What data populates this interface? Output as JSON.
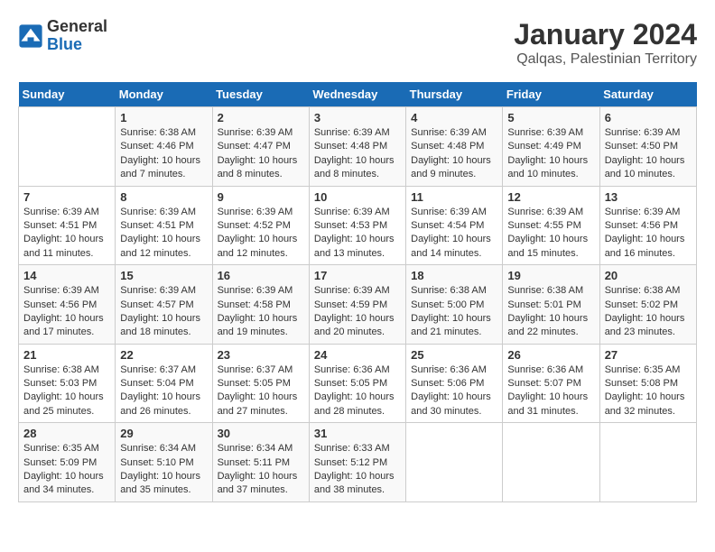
{
  "logo": {
    "general": "General",
    "blue": "Blue"
  },
  "title": "January 2024",
  "subtitle": "Qalqas, Palestinian Territory",
  "days_of_week": [
    "Sunday",
    "Monday",
    "Tuesday",
    "Wednesday",
    "Thursday",
    "Friday",
    "Saturday"
  ],
  "weeks": [
    [
      {
        "day": "",
        "info": ""
      },
      {
        "day": "1",
        "info": "Sunrise: 6:38 AM\nSunset: 4:46 PM\nDaylight: 10 hours\nand 7 minutes."
      },
      {
        "day": "2",
        "info": "Sunrise: 6:39 AM\nSunset: 4:47 PM\nDaylight: 10 hours\nand 8 minutes."
      },
      {
        "day": "3",
        "info": "Sunrise: 6:39 AM\nSunset: 4:48 PM\nDaylight: 10 hours\nand 8 minutes."
      },
      {
        "day": "4",
        "info": "Sunrise: 6:39 AM\nSunset: 4:48 PM\nDaylight: 10 hours\nand 9 minutes."
      },
      {
        "day": "5",
        "info": "Sunrise: 6:39 AM\nSunset: 4:49 PM\nDaylight: 10 hours\nand 10 minutes."
      },
      {
        "day": "6",
        "info": "Sunrise: 6:39 AM\nSunset: 4:50 PM\nDaylight: 10 hours\nand 10 minutes."
      }
    ],
    [
      {
        "day": "7",
        "info": "Sunrise: 6:39 AM\nSunset: 4:51 PM\nDaylight: 10 hours\nand 11 minutes."
      },
      {
        "day": "8",
        "info": "Sunrise: 6:39 AM\nSunset: 4:51 PM\nDaylight: 10 hours\nand 12 minutes."
      },
      {
        "day": "9",
        "info": "Sunrise: 6:39 AM\nSunset: 4:52 PM\nDaylight: 10 hours\nand 12 minutes."
      },
      {
        "day": "10",
        "info": "Sunrise: 6:39 AM\nSunset: 4:53 PM\nDaylight: 10 hours\nand 13 minutes."
      },
      {
        "day": "11",
        "info": "Sunrise: 6:39 AM\nSunset: 4:54 PM\nDaylight: 10 hours\nand 14 minutes."
      },
      {
        "day": "12",
        "info": "Sunrise: 6:39 AM\nSunset: 4:55 PM\nDaylight: 10 hours\nand 15 minutes."
      },
      {
        "day": "13",
        "info": "Sunrise: 6:39 AM\nSunset: 4:56 PM\nDaylight: 10 hours\nand 16 minutes."
      }
    ],
    [
      {
        "day": "14",
        "info": "Sunrise: 6:39 AM\nSunset: 4:56 PM\nDaylight: 10 hours\nand 17 minutes."
      },
      {
        "day": "15",
        "info": "Sunrise: 6:39 AM\nSunset: 4:57 PM\nDaylight: 10 hours\nand 18 minutes."
      },
      {
        "day": "16",
        "info": "Sunrise: 6:39 AM\nSunset: 4:58 PM\nDaylight: 10 hours\nand 19 minutes."
      },
      {
        "day": "17",
        "info": "Sunrise: 6:39 AM\nSunset: 4:59 PM\nDaylight: 10 hours\nand 20 minutes."
      },
      {
        "day": "18",
        "info": "Sunrise: 6:38 AM\nSunset: 5:00 PM\nDaylight: 10 hours\nand 21 minutes."
      },
      {
        "day": "19",
        "info": "Sunrise: 6:38 AM\nSunset: 5:01 PM\nDaylight: 10 hours\nand 22 minutes."
      },
      {
        "day": "20",
        "info": "Sunrise: 6:38 AM\nSunset: 5:02 PM\nDaylight: 10 hours\nand 23 minutes."
      }
    ],
    [
      {
        "day": "21",
        "info": "Sunrise: 6:38 AM\nSunset: 5:03 PM\nDaylight: 10 hours\nand 25 minutes."
      },
      {
        "day": "22",
        "info": "Sunrise: 6:37 AM\nSunset: 5:04 PM\nDaylight: 10 hours\nand 26 minutes."
      },
      {
        "day": "23",
        "info": "Sunrise: 6:37 AM\nSunset: 5:05 PM\nDaylight: 10 hours\nand 27 minutes."
      },
      {
        "day": "24",
        "info": "Sunrise: 6:36 AM\nSunset: 5:05 PM\nDaylight: 10 hours\nand 28 minutes."
      },
      {
        "day": "25",
        "info": "Sunrise: 6:36 AM\nSunset: 5:06 PM\nDaylight: 10 hours\nand 30 minutes."
      },
      {
        "day": "26",
        "info": "Sunrise: 6:36 AM\nSunset: 5:07 PM\nDaylight: 10 hours\nand 31 minutes."
      },
      {
        "day": "27",
        "info": "Sunrise: 6:35 AM\nSunset: 5:08 PM\nDaylight: 10 hours\nand 32 minutes."
      }
    ],
    [
      {
        "day": "28",
        "info": "Sunrise: 6:35 AM\nSunset: 5:09 PM\nDaylight: 10 hours\nand 34 minutes."
      },
      {
        "day": "29",
        "info": "Sunrise: 6:34 AM\nSunset: 5:10 PM\nDaylight: 10 hours\nand 35 minutes."
      },
      {
        "day": "30",
        "info": "Sunrise: 6:34 AM\nSunset: 5:11 PM\nDaylight: 10 hours\nand 37 minutes."
      },
      {
        "day": "31",
        "info": "Sunrise: 6:33 AM\nSunset: 5:12 PM\nDaylight: 10 hours\nand 38 minutes."
      },
      {
        "day": "",
        "info": ""
      },
      {
        "day": "",
        "info": ""
      },
      {
        "day": "",
        "info": ""
      }
    ]
  ]
}
